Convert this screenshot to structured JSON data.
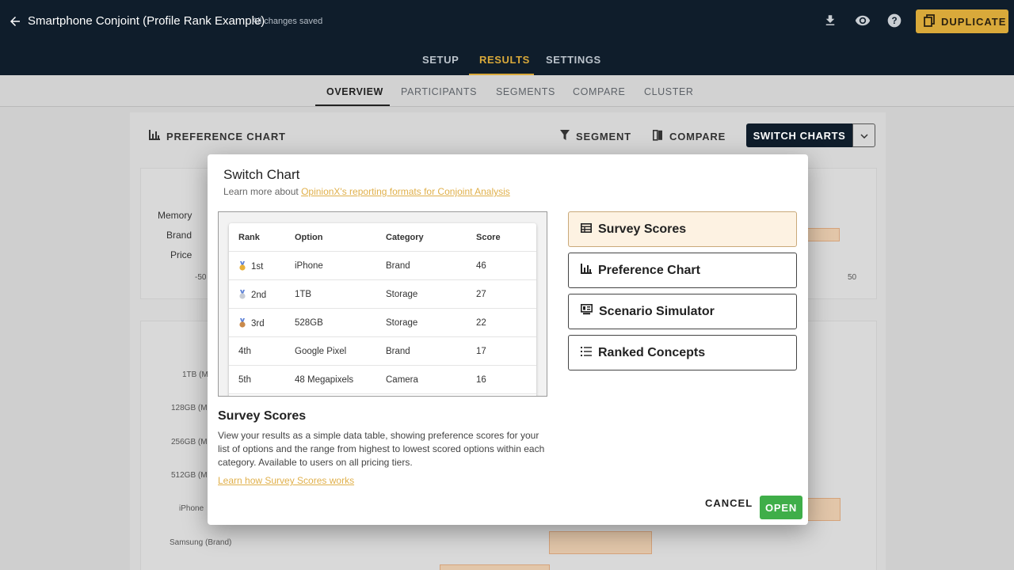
{
  "app": {
    "title": "Smartphone Conjoint (Profile Rank Example)",
    "save_status": "All changes saved",
    "duplicate_label": "DUPLICATE"
  },
  "main_tabs": [
    {
      "label": "SETUP"
    },
    {
      "label": "RESULTS"
    },
    {
      "label": "SETTINGS"
    }
  ],
  "sub_tabs": [
    {
      "label": "OVERVIEW"
    },
    {
      "label": "PARTICIPANTS"
    },
    {
      "label": "SEGMENTS"
    },
    {
      "label": "COMPARE"
    },
    {
      "label": "CLUSTER"
    }
  ],
  "card": {
    "title": "PREFERENCE CHART",
    "segment_label": "SEGMENT",
    "compare_label": "COMPARE",
    "switch_label": "SWITCH CHARTS",
    "top_chart_labels": [
      "Memory",
      "Brand",
      "Price"
    ],
    "top_axis": [
      "-50",
      "50"
    ],
    "bottom_chart_labels": [
      "1TB (M",
      "128GB (M",
      "256GB (M",
      "512GB (M",
      "iPhone",
      "Samsung  (Brand)"
    ]
  },
  "modal": {
    "title": "Switch Chart",
    "subtitle_prefix": "Learn more about ",
    "subtitle_link": "OpinionX's reporting formats for Conjoint Analysis",
    "preview_table": {
      "headers": [
        "Rank",
        "Option",
        "Category",
        "Score"
      ],
      "rows": [
        {
          "rank": "1st",
          "option": "iPhone",
          "category": "Brand",
          "score": "46",
          "medal": "gold"
        },
        {
          "rank": "2nd",
          "option": "1TB",
          "category": "Storage",
          "score": "27",
          "medal": "silver"
        },
        {
          "rank": "3rd",
          "option": "528GB",
          "category": "Storage",
          "score": "22",
          "medal": "bronze"
        },
        {
          "rank": "4th",
          "option": "Google Pixel",
          "category": "Brand",
          "score": "17"
        },
        {
          "rank": "5th",
          "option": "48 Megapixels",
          "category": "Camera",
          "score": "16"
        }
      ]
    },
    "desc_title": "Survey Scores",
    "desc_body": "View your results as a simple data table, showing preference scores for your list of options and the range from highest to lowest scored options within each category. Available to users on all pricing tiers.",
    "desc_link": "Learn how Survey Scores works",
    "options": [
      {
        "label": "Survey Scores",
        "icon": "table-icon",
        "selected": true
      },
      {
        "label": "Preference Chart",
        "icon": "bar-chart-icon",
        "selected": false
      },
      {
        "label": "Scenario Simulator",
        "icon": "simulator-icon",
        "selected": false
      },
      {
        "label": "Ranked Concepts",
        "icon": "list-icon",
        "selected": false
      }
    ],
    "cancel_label": "CANCEL",
    "open_label": "OPEN"
  },
  "colors": {
    "topbar": "#0f1d2b",
    "accent": "#d9a93a",
    "open_button": "#3fae49",
    "selected_option": "#fdf2e2"
  }
}
